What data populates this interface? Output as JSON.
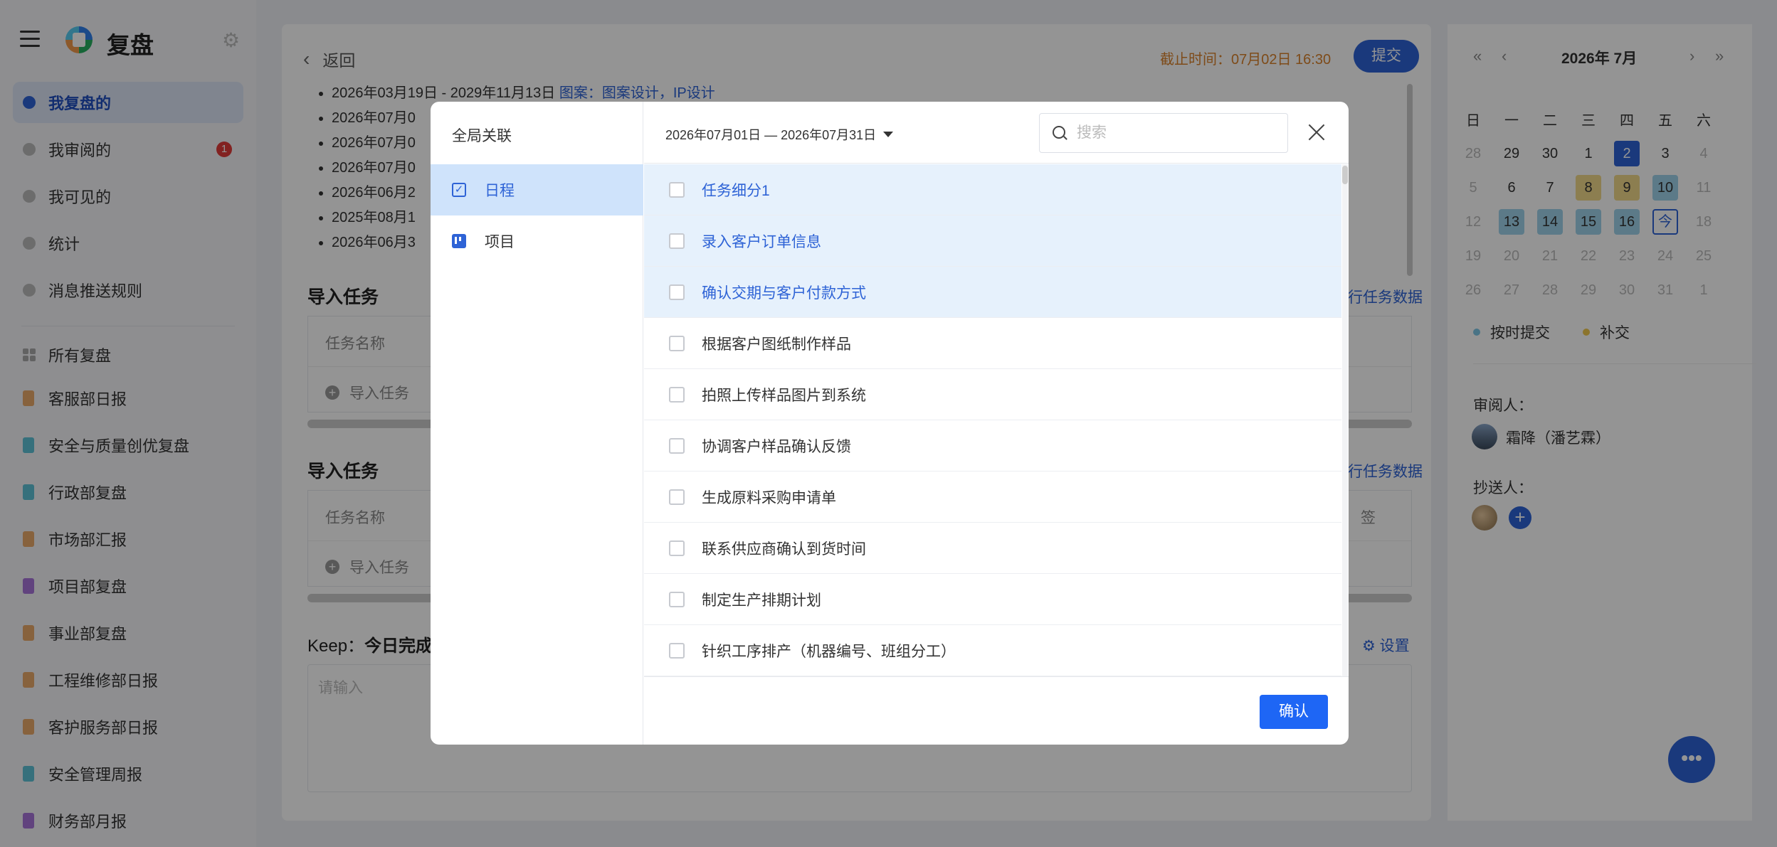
{
  "app": {
    "title": "复盘",
    "menu_icon": "hamburger-menu-icon",
    "settings_icon": "gear-icon"
  },
  "sidebar": {
    "items": [
      {
        "label": "我复盘的",
        "icon": "person-icon"
      },
      {
        "label": "我审阅的",
        "icon": "review-icon",
        "badge": "1"
      },
      {
        "label": "我可见的",
        "icon": "eye-icon"
      },
      {
        "label": "统计",
        "icon": "pie-chart-icon"
      },
      {
        "label": "消息推送规则",
        "icon": "edit-icon"
      }
    ],
    "all_label": "所有复盘",
    "books": [
      {
        "label": "客服部日报",
        "color": "#e8a96a"
      },
      {
        "label": "安全与质量创优复盘",
        "color": "#5ec2d6"
      },
      {
        "label": "行政部复盘",
        "color": "#5ec2d6"
      },
      {
        "label": "市场部汇报",
        "color": "#e8a96a"
      },
      {
        "label": "项目部复盘",
        "color": "#a874d9"
      },
      {
        "label": "事业部复盘",
        "color": "#e8a96a"
      },
      {
        "label": "工程维修部日报",
        "color": "#e8a96a"
      },
      {
        "label": "客护服务部日报",
        "color": "#e8a96a"
      },
      {
        "label": "安全管理周报",
        "color": "#5ec2d6"
      },
      {
        "label": "财务部月报",
        "color": "#a874d9"
      }
    ]
  },
  "main": {
    "back_label": "返回",
    "deadline": "截止时间：07月02日 16:30",
    "submit_label": "提交",
    "bullets": [
      {
        "text": "2026年03月19日 - 2029年11月13日 ",
        "link": "图案：图案设计，IP设计"
      },
      {
        "text": "2026年07月0"
      },
      {
        "text": "2026年07月0"
      },
      {
        "text": "2026年07月0"
      },
      {
        "text": "2026年06月2"
      },
      {
        "text": "2025年08月1"
      },
      {
        "text": "2026年06月3"
      }
    ],
    "sections": [
      {
        "title": "导入任务",
        "link": "行任务数据",
        "col_name": "任务名称",
        "import_label": "导入任务"
      },
      {
        "title": "导入任务",
        "link": "行任务数据",
        "col_name": "任务名称",
        "import_label": "导入任务",
        "col_right": "签"
      }
    ],
    "keep_prefix": "Keep：",
    "keep_title": "今日完成",
    "setting_label": "设置",
    "textarea_placeholder": "请输入"
  },
  "calendar": {
    "title": "2026年 7月",
    "weekdays": [
      "日",
      "一",
      "二",
      "三",
      "四",
      "五",
      "六"
    ],
    "days": [
      {
        "d": "28",
        "s": "gray"
      },
      {
        "d": "29",
        "s": ""
      },
      {
        "d": "30",
        "s": ""
      },
      {
        "d": "1",
        "s": ""
      },
      {
        "d": "2",
        "s": "sel"
      },
      {
        "d": "3",
        "s": ""
      },
      {
        "d": "4",
        "s": "gray"
      },
      {
        "d": "5",
        "s": "gray"
      },
      {
        "d": "6",
        "s": ""
      },
      {
        "d": "7",
        "s": ""
      },
      {
        "d": "8",
        "s": "yel"
      },
      {
        "d": "9",
        "s": "yel"
      },
      {
        "d": "10",
        "s": "blu"
      },
      {
        "d": "11",
        "s": "gray"
      },
      {
        "d": "12",
        "s": "gray"
      },
      {
        "d": "13",
        "s": "blu"
      },
      {
        "d": "14",
        "s": "blu"
      },
      {
        "d": "15",
        "s": "blu"
      },
      {
        "d": "16",
        "s": "blu"
      },
      {
        "d": "今",
        "s": "today"
      },
      {
        "d": "18",
        "s": "gray"
      },
      {
        "d": "19",
        "s": "gray"
      },
      {
        "d": "20",
        "s": "gray"
      },
      {
        "d": "21",
        "s": "gray"
      },
      {
        "d": "22",
        "s": "gray"
      },
      {
        "d": "23",
        "s": "gray"
      },
      {
        "d": "24",
        "s": "gray"
      },
      {
        "d": "25",
        "s": "gray"
      },
      {
        "d": "26",
        "s": "gray"
      },
      {
        "d": "27",
        "s": "gray"
      },
      {
        "d": "28",
        "s": "gray"
      },
      {
        "d": "29",
        "s": "gray"
      },
      {
        "d": "30",
        "s": "gray"
      },
      {
        "d": "31",
        "s": "gray"
      },
      {
        "d": "1",
        "s": "gray"
      }
    ],
    "legend": [
      {
        "label": "按时提交",
        "color": "#7fc6e6"
      },
      {
        "label": "补交",
        "color": "#f0c94e"
      }
    ],
    "reviewer_label": "审阅人：",
    "reviewer_name": "霜降（潘艺霖）",
    "cc_label": "抄送人："
  },
  "modal": {
    "left_title": "全局关联",
    "categories": [
      {
        "label": "日程",
        "icon": "checkbox-calendar-icon",
        "active": true
      },
      {
        "label": "项目",
        "icon": "kanban-board-icon",
        "active": false
      }
    ],
    "date_range": "2026年07月01日 — 2026年07月31日",
    "search_placeholder": "搜索",
    "tasks": [
      {
        "label": "任务细分1",
        "highlight": true
      },
      {
        "label": "录入客户订单信息",
        "highlight": true
      },
      {
        "label": "确认交期与客户付款方式",
        "highlight": true
      },
      {
        "label": "根据客户图纸制作样品",
        "highlight": false
      },
      {
        "label": "拍照上传样品图片到系统",
        "highlight": false
      },
      {
        "label": "协调客户样品确认反馈",
        "highlight": false
      },
      {
        "label": "生成原料采购申请单",
        "highlight": false
      },
      {
        "label": "联系供应商确认到货时间",
        "highlight": false
      },
      {
        "label": "制定生产排期计划",
        "highlight": false
      },
      {
        "label": "针织工序排产（机器编号、班组分工）",
        "highlight": false
      }
    ],
    "confirm_label": "确认"
  },
  "fab_label": "•••"
}
